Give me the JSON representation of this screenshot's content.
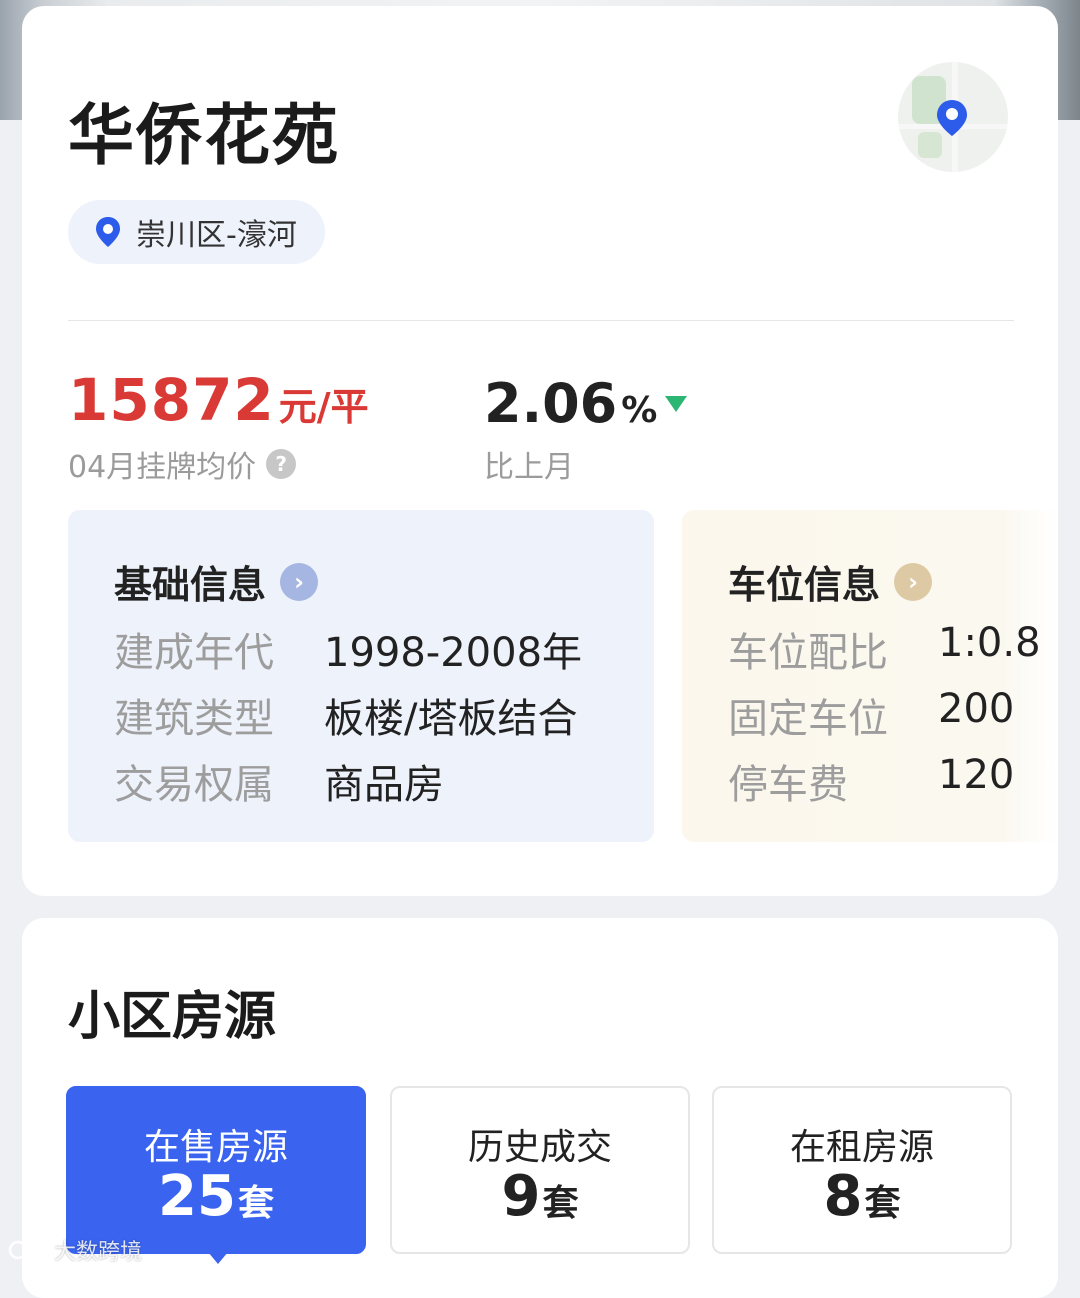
{
  "community": {
    "name": "华侨花苑",
    "location": "崇川区-濠河"
  },
  "price": {
    "value": "15872",
    "unit": "元/平",
    "label": "04月挂牌均价",
    "help_icon": "question-icon"
  },
  "change": {
    "value": "2.06",
    "unit": "%",
    "direction": "down",
    "label": "比上月",
    "color": "#2bb673"
  },
  "basic_info": {
    "title": "基础信息",
    "rows": [
      {
        "key": "建成年代",
        "value": "1998-2008年"
      },
      {
        "key": "建筑类型",
        "value": "板楼/塔板结合"
      },
      {
        "key": "交易权属",
        "value": "商品房"
      }
    ]
  },
  "parking_info": {
    "title": "车位信息",
    "rows": [
      {
        "key": "车位配比",
        "value": "1:0.8"
      },
      {
        "key": "固定车位",
        "value": "200"
      },
      {
        "key": "停车费",
        "value": "120"
      }
    ]
  },
  "listings": {
    "title": "小区房源",
    "tabs": [
      {
        "label": "在售房源",
        "count": "25",
        "unit": "套",
        "active": true
      },
      {
        "label": "历史成交",
        "count": "9",
        "unit": "套",
        "active": false
      },
      {
        "label": "在租房源",
        "count": "8",
        "unit": "套",
        "active": false
      }
    ]
  },
  "watermark": "大数跨境",
  "colors": {
    "accent": "#3a64f0",
    "price": "#d93a35",
    "down": "#2bb673"
  }
}
